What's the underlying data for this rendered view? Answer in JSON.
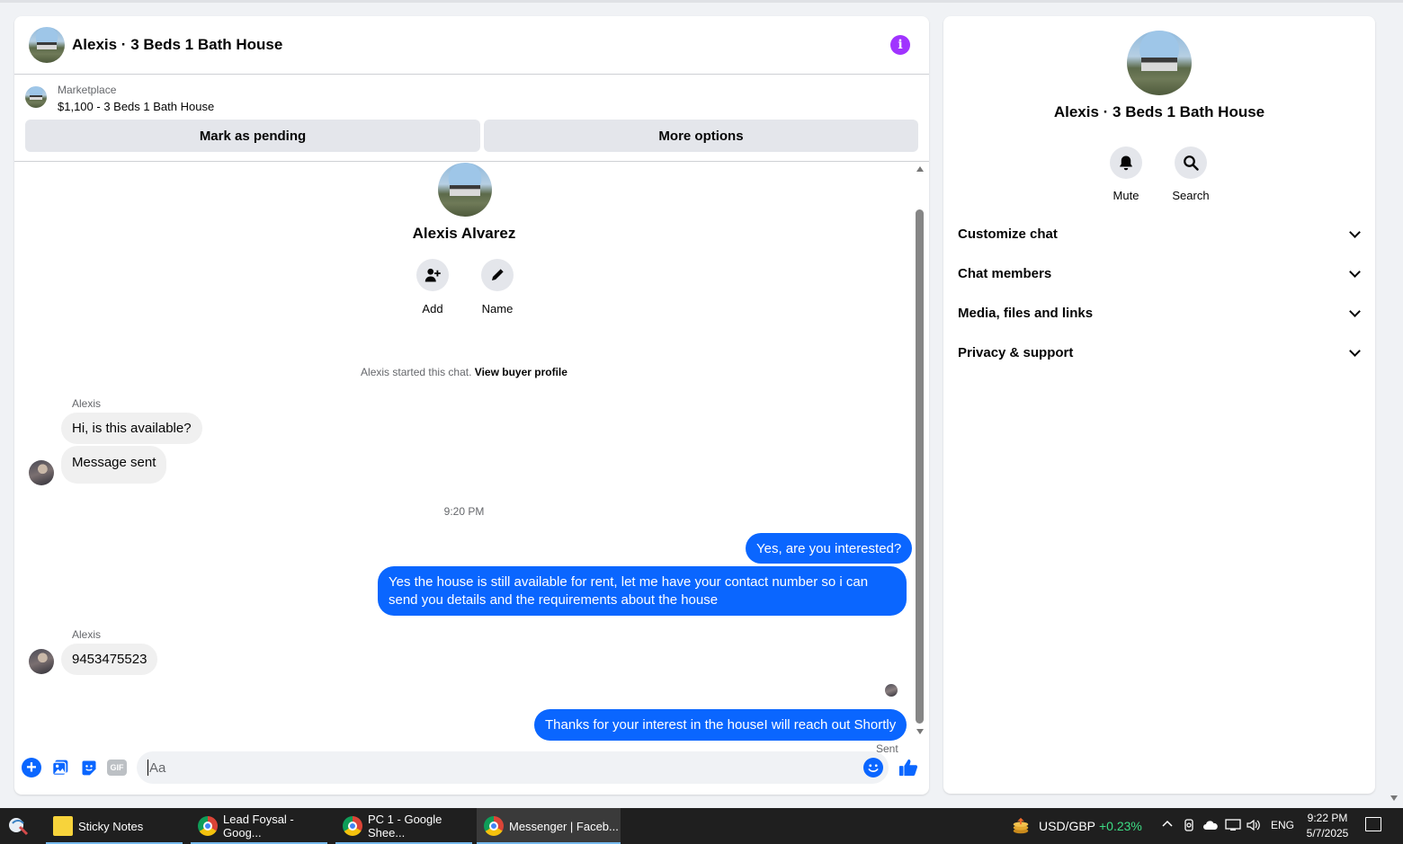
{
  "chat": {
    "title": "Alexis · 3 Beds 1 Bath House",
    "marketplace_label": "Marketplace",
    "listing": "$1,100 - 3 Beds 1 Bath House",
    "mark_pending_label": "Mark as pending",
    "more_options_label": "More options",
    "profile_name": "Alexis Alvarez",
    "add_label": "Add",
    "name_label": "Name",
    "started_text": "Alexis started this chat.",
    "view_profile_link": "View buyer profile",
    "timestamp": "9:20 PM",
    "sent_status": "Sent",
    "composer_placeholder": "Aa",
    "messages": [
      {
        "direction": "incoming",
        "sender": "Alexis",
        "text": "Hi, is this available?"
      },
      {
        "direction": "incoming",
        "text": "Message sent"
      },
      {
        "direction": "outgoing",
        "text": "Yes, are you interested?"
      },
      {
        "direction": "outgoing",
        "text": "Yes the house is still available for rent, let me have your contact number so i can send you details and the requirements about the house"
      },
      {
        "direction": "incoming",
        "sender": "Alexis",
        "text": "9453475523"
      },
      {
        "direction": "outgoing",
        "text": "Thanks for your interest in the houseI will reach out Shortly"
      }
    ]
  },
  "panel": {
    "title": "Alexis · 3 Beds 1 Bath House",
    "mute_label": "Mute",
    "search_label": "Search",
    "sections": [
      "Customize chat",
      "Chat members",
      "Media, files and links",
      "Privacy & support"
    ]
  },
  "taskbar": {
    "items": [
      "Sticky Notes",
      "Lead Foysal - Goog...",
      "PC 1 - Google Shee...",
      "Messenger | Faceb..."
    ],
    "fx_pair": "USD/GBP",
    "fx_change": "+0.23%",
    "language": "ENG",
    "time": "9:22 PM",
    "date": "5/7/2025"
  },
  "colors": {
    "accent": "#0a66ff",
    "info_icon": "#a033ff",
    "incoming_bubble": "#f0f0f0",
    "fx_change": "#3ddc84"
  },
  "icons": [
    "info-icon",
    "add-person-icon",
    "pencil-icon",
    "bell-icon",
    "search-icon",
    "chevron-down-icon",
    "plus-icon",
    "photo-icon",
    "sticker-icon",
    "gif-icon",
    "emoji-icon",
    "thumbs-up-icon"
  ]
}
